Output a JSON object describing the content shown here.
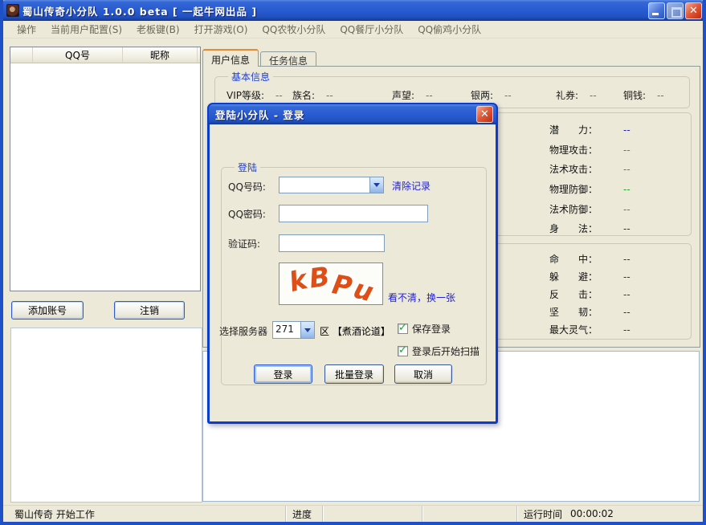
{
  "window": {
    "title": "蜀山传奇小分队 1.0.0 beta [ 一起牛网出品 ]"
  },
  "menu": {
    "items": [
      "操作",
      "当前用户配置(S)",
      "老板键(B)",
      "打开游戏(O)",
      "QQ农牧小分队",
      "QQ餐厅小分队",
      "QQ偷鸡小分队"
    ]
  },
  "account_list": {
    "columns": [
      "",
      "QQ号",
      "昵称"
    ]
  },
  "left_buttons": {
    "add_account": "添加账号",
    "logout": "注销"
  },
  "tabs": [
    {
      "label": "用户信息"
    },
    {
      "label": "任务信息"
    }
  ],
  "basic_info": {
    "title": "基本信息",
    "fields": [
      {
        "label": "VIP等级:",
        "value": "--"
      },
      {
        "label": "族名:",
        "value": "--"
      },
      {
        "label": "声望:",
        "value": "--"
      },
      {
        "label": "银两:",
        "value": "--"
      },
      {
        "label": "礼券:",
        "value": "--"
      },
      {
        "label": "铜钱:",
        "value": "--"
      }
    ]
  },
  "stats_primary": [
    {
      "label": "潜　　力：",
      "value": "--"
    },
    {
      "label": "物理攻击：",
      "value": "--"
    },
    {
      "label": "法术攻击：",
      "value": "--"
    },
    {
      "label": "物理防御：",
      "value": "--"
    },
    {
      "label": "法术防御：",
      "value": "--"
    },
    {
      "label": "身　　法：",
      "value": "--"
    }
  ],
  "stats_secondary": [
    {
      "label": "命　　中：",
      "value": "--"
    },
    {
      "label": "躲　　避：",
      "value": "--"
    },
    {
      "label": "反　　击：",
      "value": "--"
    },
    {
      "label": "坚　　韧：",
      "value": "--"
    },
    {
      "label": "最大灵气：",
      "value": "--"
    }
  ],
  "login_dialog": {
    "title": "登陆小分队 - 登录",
    "group_title": "登陆",
    "qq_label": "QQ号码:",
    "qq_value": "",
    "clear_link": "清除记录",
    "password_label": "QQ密码:",
    "password_value": "",
    "captcha_label": "验证码:",
    "captcha_value": "",
    "captcha_letters": [
      "k",
      "B",
      "P",
      "u"
    ],
    "refresh_link": "看不清，换一张",
    "server_label": "选择服务器",
    "server_value": "271",
    "server_suffix": "区 【煮酒论道】",
    "save_login_label": "保存登录",
    "scan_after_login_label": "登录后开始扫描",
    "login_button": "登录",
    "batch_login_button": "批量登录",
    "cancel_button": "取消"
  },
  "statusbar": {
    "status": "蜀山传奇 开始工作",
    "progress_label": "进度",
    "runtime_label": "运行时间",
    "runtime_value": "00:00:02"
  },
  "colors": {
    "titlebar_blue": "#2A5CD2",
    "window_bg": "#ECE9D8",
    "active_tab_accent": "#E68B2C",
    "link_blue": "#1F1FD1",
    "value_green": "#17B117",
    "value_blue": "#2020D8",
    "captcha_orange": "#DD4F17",
    "close_red": "#C22B10"
  }
}
